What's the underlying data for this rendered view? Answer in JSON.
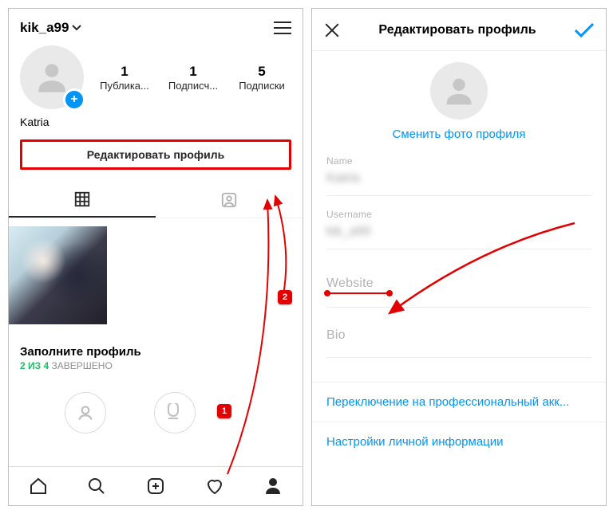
{
  "left": {
    "username": "kik_a99",
    "display_name": "Katria",
    "stats": {
      "posts": {
        "count": "1",
        "label": "Публика..."
      },
      "followers": {
        "count": "1",
        "label": "Подписч..."
      },
      "following": {
        "count": "5",
        "label": "Подписки"
      }
    },
    "edit_profile_label": "Редактировать профиль",
    "complete_title": "Заполните профиль",
    "complete_done": "2 ИЗ 4",
    "complete_rest": "ЗАВЕРШЕНО"
  },
  "right": {
    "title": "Редактировать профиль",
    "change_photo": "Сменить фото профиля",
    "fields": {
      "name_label": "Name",
      "name_value": "Katria",
      "username_label": "Username",
      "username_value": "kik_a99",
      "website_label": "Website",
      "bio_label": "Bio"
    },
    "link_pro": "Переключение на профессиональный акк...",
    "link_personal": "Настройки личной информации"
  },
  "annotations": {
    "badge1": "1",
    "badge2": "2"
  }
}
